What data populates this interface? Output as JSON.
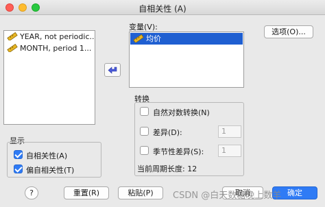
{
  "window": {
    "title": "自相关性 (A)"
  },
  "source_list": {
    "items": [
      {
        "label": "YEAR, not periodic...",
        "icon": "ruler-scale-icon"
      },
      {
        "label": "MONTH, period 1...",
        "icon": "ruler-scale-icon"
      }
    ]
  },
  "variables": {
    "label": "变量(V):",
    "items": [
      {
        "label": "均价",
        "icon": "ruler-scale-icon"
      }
    ]
  },
  "options_button": "选项(O)...",
  "transform": {
    "title": "转换",
    "natural_log": {
      "label": "自然对数转换(N)",
      "checked": false
    },
    "difference": {
      "label": "差异(D):",
      "checked": false,
      "value": "1"
    },
    "seasonal_difference": {
      "label": "季节性差异(S):",
      "checked": false,
      "value": "1"
    },
    "current_period": "当前周期长度:  12"
  },
  "display": {
    "title": "显示",
    "autocorrelation": {
      "label": "自相关性(A)",
      "checked": true
    },
    "partial_autocorrelation": {
      "label": "偏自相关性(T)",
      "checked": true
    }
  },
  "footer": {
    "help": "?",
    "reset": "重置(R)",
    "paste": "粘贴(P)",
    "cancel": "取消",
    "ok": "确定"
  },
  "watermark": "CSDN @白天数糖晚上数羊",
  "colors": {
    "selection": "#1f5fd1",
    "primary_button": "#2f7bf5"
  }
}
